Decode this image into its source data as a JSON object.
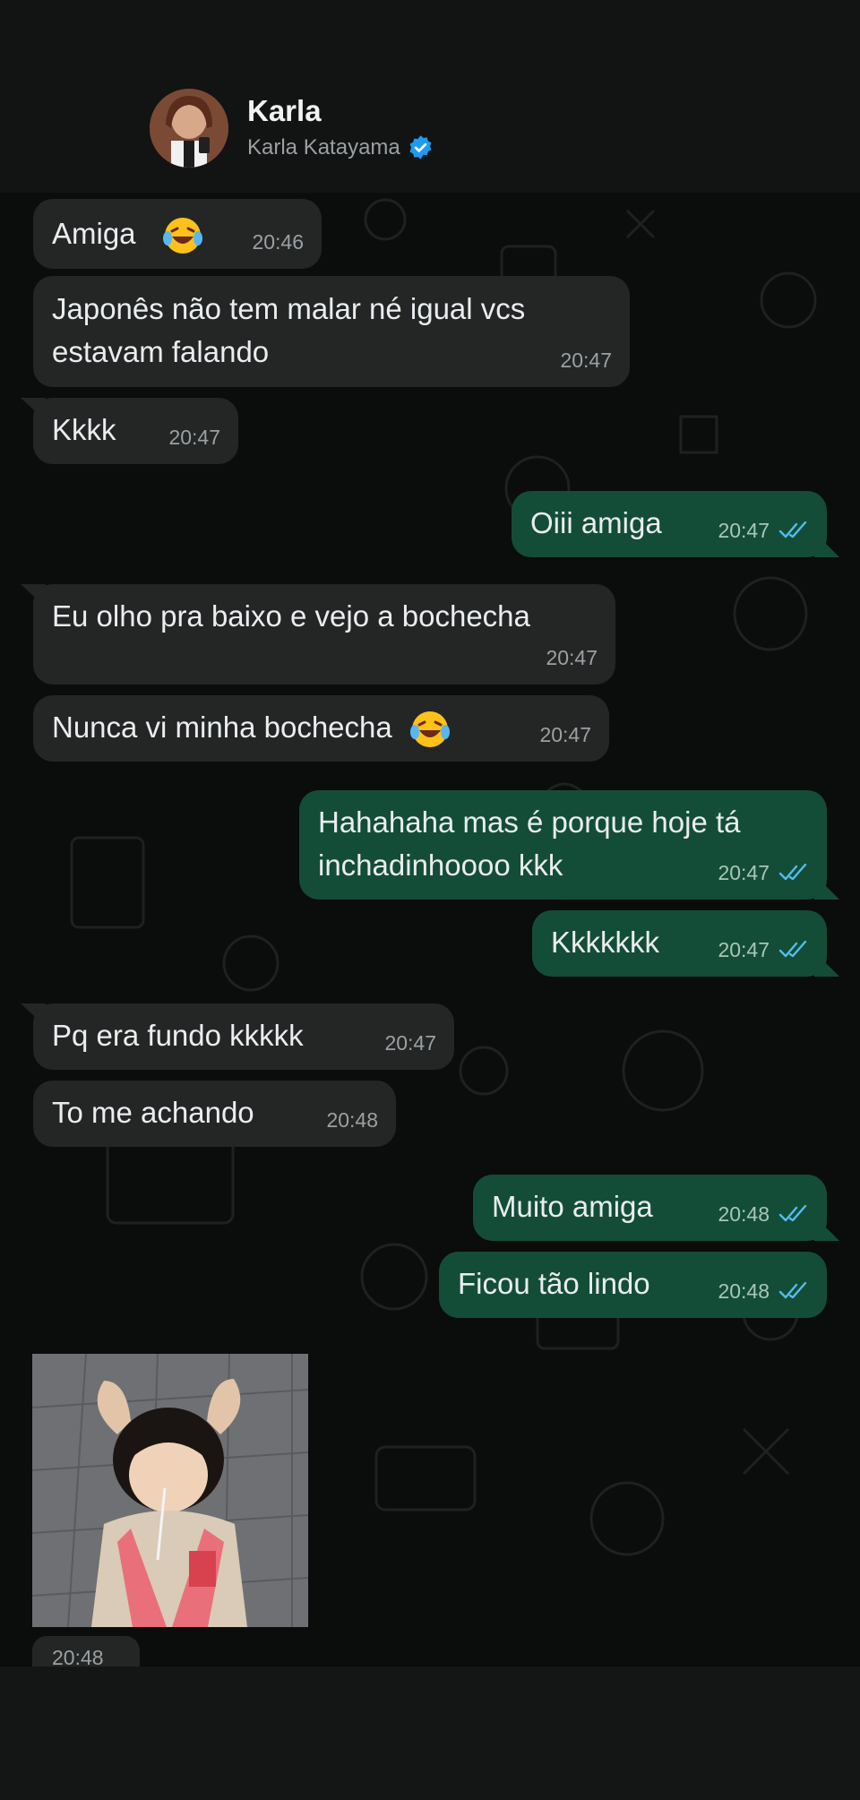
{
  "header": {
    "name": "Karla",
    "subtitle": "Karla Katayama"
  },
  "messages": [
    {
      "text": "Amiga",
      "time": "20:46",
      "dir": "in"
    },
    {
      "text": "Japonês não tem malar né  igual vcs estavam falando",
      "line1": "Japonês não tem malar né  igual vcs",
      "line2": "estavam falando",
      "time": "20:47",
      "dir": "in"
    },
    {
      "text": "Kkkk",
      "time": "20:47",
      "dir": "in"
    },
    {
      "text": "Oiii amiga",
      "time": "20:47",
      "dir": "out",
      "status": "read"
    },
    {
      "text": "Eu olho pra baixo e vejo a bochecha",
      "time": "20:47",
      "dir": "in"
    },
    {
      "text": "Nunca vi minha bochecha",
      "time": "20:47",
      "dir": "in"
    },
    {
      "text": "Hahahaha mas é porque hoje tá inchadinhoooo kkk",
      "line1": "Hahahaha mas é porque hoje tá",
      "line2": "inchadinhoooo kkk",
      "time": "20:47",
      "dir": "out",
      "status": "read"
    },
    {
      "text": "Kkkkkkk",
      "time": "20:47",
      "dir": "out",
      "status": "read"
    },
    {
      "text": "Pq era fundo kkkkk",
      "time": "20:47",
      "dir": "in"
    },
    {
      "text": "To me achando",
      "time": "20:48",
      "dir": "in"
    },
    {
      "text": "Muito amiga",
      "time": "20:48",
      "dir": "out",
      "status": "read"
    },
    {
      "text": "Ficou tão lindo",
      "time": "20:48",
      "dir": "out",
      "status": "read"
    },
    {
      "text": "",
      "time": "20:48",
      "dir": "in",
      "type": "image"
    }
  ],
  "colors": {
    "incoming": "#242626",
    "outgoing": "#144d37",
    "read_tick": "#53bdeb",
    "verified": "#1d9bf0"
  },
  "icons": [
    "verified-badge-icon",
    "double-check-icon",
    "laughing-emoji-icon"
  ]
}
